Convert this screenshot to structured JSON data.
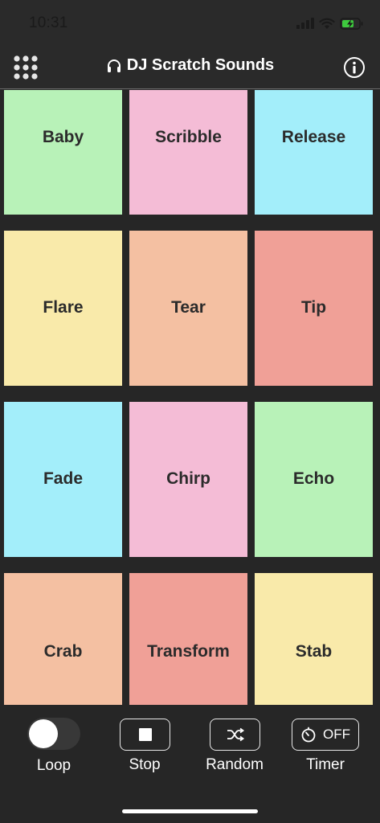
{
  "status_bar": {
    "time": "10:31"
  },
  "nav": {
    "title": "DJ Scratch Sounds"
  },
  "pads": [
    {
      "label": "Baby",
      "color": "#b8f2b8"
    },
    {
      "label": "Scribble",
      "color": "#f4bcd6"
    },
    {
      "label": "Release",
      "color": "#a3eefa"
    },
    {
      "label": "Flare",
      "color": "#f9eaaa"
    },
    {
      "label": "Tear",
      "color": "#f4c0a2"
    },
    {
      "label": "Tip",
      "color": "#f0a097"
    },
    {
      "label": "Fade",
      "color": "#a3eefa"
    },
    {
      "label": "Chirp",
      "color": "#f4bcd6"
    },
    {
      "label": "Echo",
      "color": "#b8f2b8"
    },
    {
      "label": "Crab",
      "color": "#f4c0a2"
    },
    {
      "label": "Transform",
      "color": "#f0a097"
    },
    {
      "label": "Stab",
      "color": "#f9eaaa"
    }
  ],
  "toolbar": {
    "loop_label": "Loop",
    "loop_on": false,
    "stop_label": "Stop",
    "random_label": "Random",
    "timer_label": "Timer",
    "timer_value": "OFF"
  }
}
